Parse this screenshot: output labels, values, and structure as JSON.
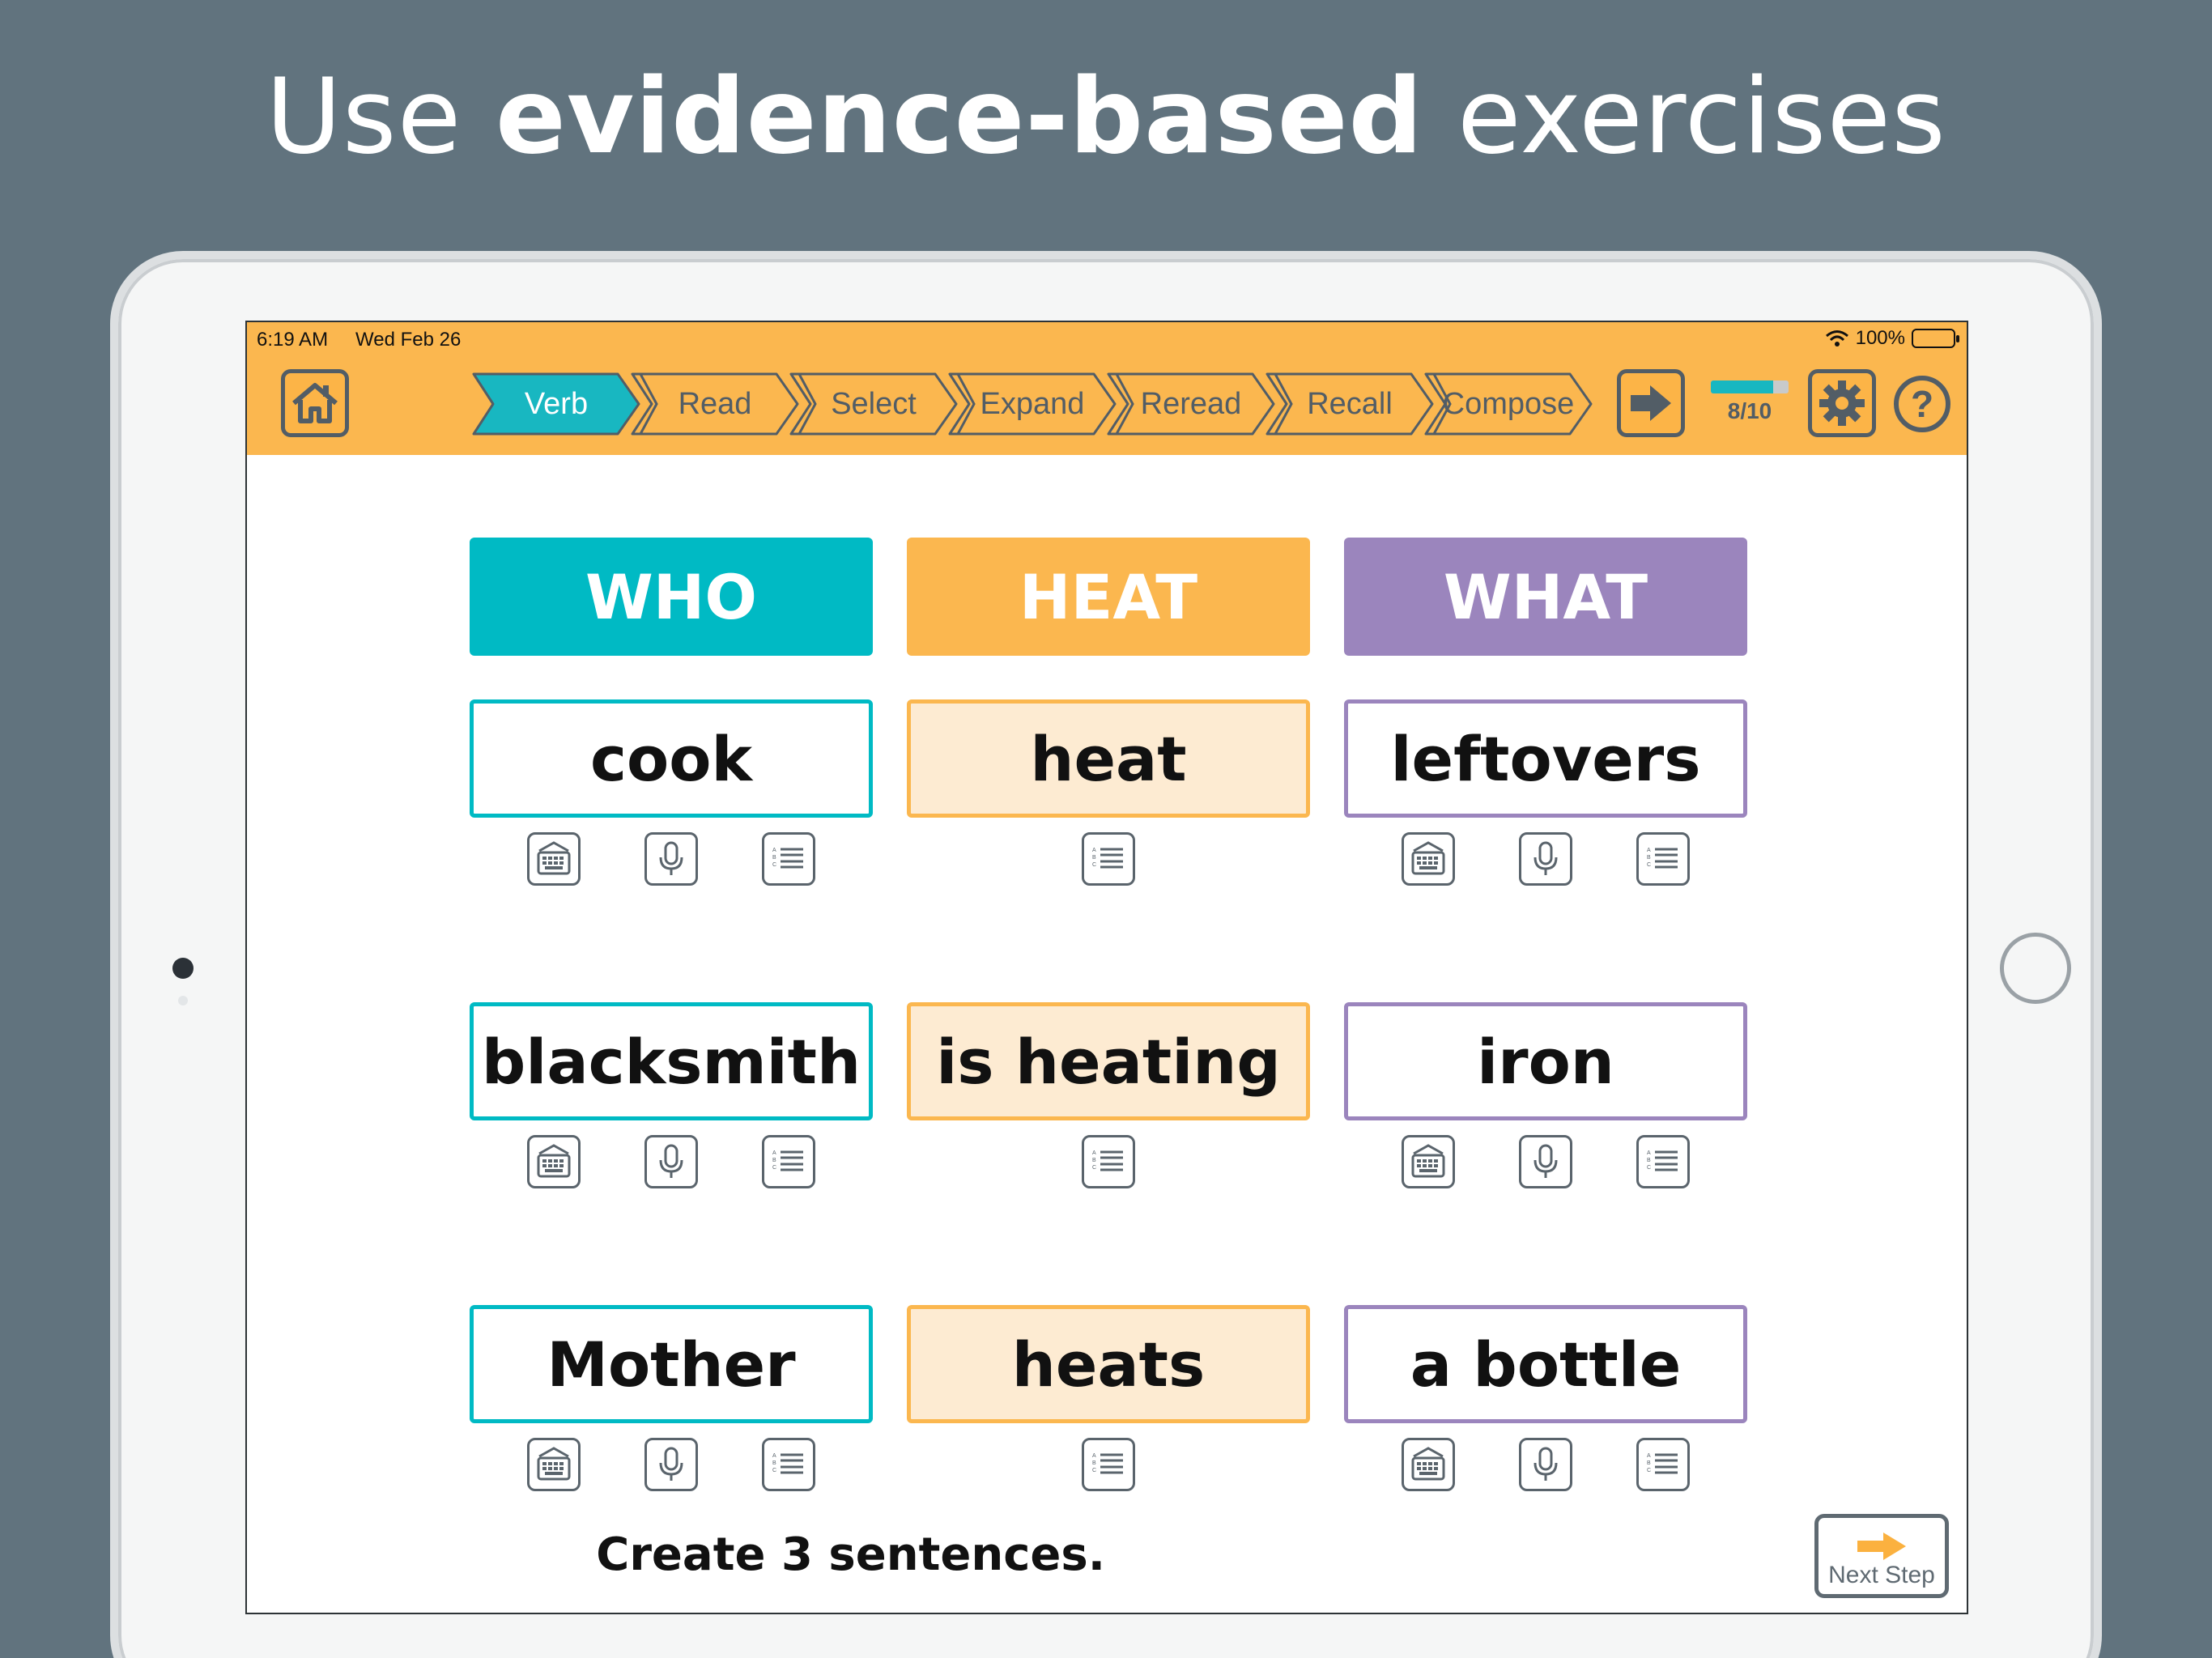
{
  "headline": {
    "prefix": "Use",
    "bold": "evidence-based",
    "suffix": "exercises"
  },
  "status_bar": {
    "time": "6:19 AM",
    "date": "Wed Feb 26",
    "battery": "100%"
  },
  "toolbar": {
    "home_icon": "home-icon",
    "steps": [
      "Verb",
      "Read",
      "Select",
      "Expand",
      "Reread",
      "Recall",
      "Compose"
    ],
    "active_step": "Verb",
    "next_icon": "arrow-right-icon",
    "progress": {
      "current": 8,
      "total": 10,
      "label": "8/10"
    },
    "settings_icon": "gear-icon",
    "help_label": "?"
  },
  "colors": {
    "who": "#00bac4",
    "heat": "#fbb74f",
    "what": "#9b85bd",
    "bar": "#fbb74f"
  },
  "columns": [
    {
      "header": "WHO",
      "words": [
        "cook",
        "blacksmith",
        "Mother"
      ],
      "controls": [
        "keyboard-icon",
        "microphone-icon",
        "list-icon"
      ]
    },
    {
      "header": "HEAT",
      "words": [
        "heat",
        "is heating",
        "heats"
      ],
      "controls": [
        "list-icon"
      ]
    },
    {
      "header": "WHAT",
      "words": [
        "leftovers",
        "iron",
        "a bottle"
      ],
      "controls": [
        "keyboard-icon",
        "microphone-icon",
        "list-icon"
      ]
    }
  ],
  "prompt": "Create 3 sentences.",
  "next_step_label": "Next Step"
}
